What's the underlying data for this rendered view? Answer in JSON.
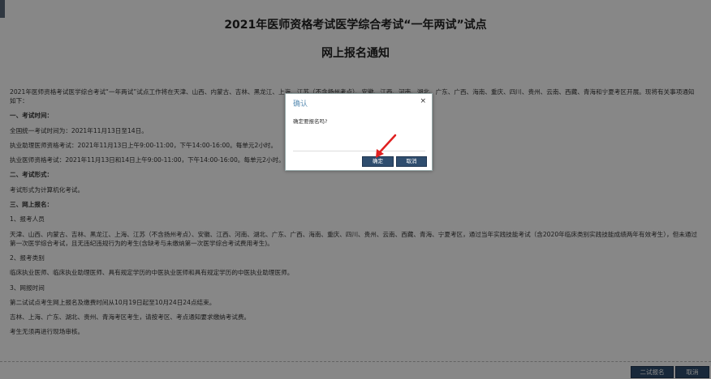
{
  "header": {
    "title": "2021年医师资格考试医学综合考试“一年两试”试点",
    "subtitle": "网上报名通知"
  },
  "content": {
    "intro": "2021年医师资格考试医学综合考试“一年两试”试点工作将在天津、山西、内蒙古、吉林、黑龙江、上海、江苏（不含扬州考点）、安徽、江西、河南、湖北、广东、广西、海南、重庆、四川、贵州、云南、西藏、青海和宁夏考区开展。现将有关事项通知如下：",
    "s1_heading": "一、考试时间：",
    "s1_line1": "全国统一考试时间为：2021年11月13日至14日。",
    "s1_line2": "执业助理医师资格考试：2021年11月13日上午9:00-11:00，下午14:00-16:00。每单元2小时。",
    "s1_line3": "执业医师资格考试：2021年11月13日和14日上午9:00-11:00，下午14:00-16:00。每单元2小时。",
    "s2_heading": "二、考试形式：",
    "s2_line1": "考试形式为计算机化考试。",
    "s3_heading": "三、网上报名：",
    "s3_sub1": "1、报考人员",
    "s3_sub1_text": "天津、山西、内蒙古、吉林、黑龙江、上海、江苏（不含扬州考点）、安徽、江西、河南、湖北、广东、广西、海南、重庆、四川、贵州、云南、西藏、青海、宁夏考区，通过当年实践技能考试（含2020年临床类别实践技能成绩两年有效考生），但未通过第一次医学综合考试，且无违纪违规行为的考生(含缺考与未缴纳第一次医学综合考试费用考生)。",
    "s3_sub2": "2、报考类别",
    "s3_sub2_text": "临床执业医师、临床执业助理医师、具有规定学历的中医执业医师和具有规定学历的中医执业助理医师。",
    "s3_sub3": "3、网报时间",
    "s3_sub3_text": "第二试试点考生网上报名及缴费时间从10月19日起至10月24日24点结束。",
    "s3_line_a": "吉林、上海、广东、湖北、贵州、青海考区考生，请按考区、考点通知要求缴纳考试费。",
    "s3_line_b": "考生无须再进行现场审核。"
  },
  "footer": {
    "apply_label": "二试报名",
    "cancel_label": "取消"
  },
  "dialog": {
    "title": "确认",
    "close_glyph": "×",
    "message": "确定要报名吗?",
    "ok_label": "确定",
    "cancel_label": "取消"
  },
  "colors": {
    "button_bg": "#2f4d6e",
    "dialog_title": "#5a8db3",
    "arrow": "#e02020"
  }
}
